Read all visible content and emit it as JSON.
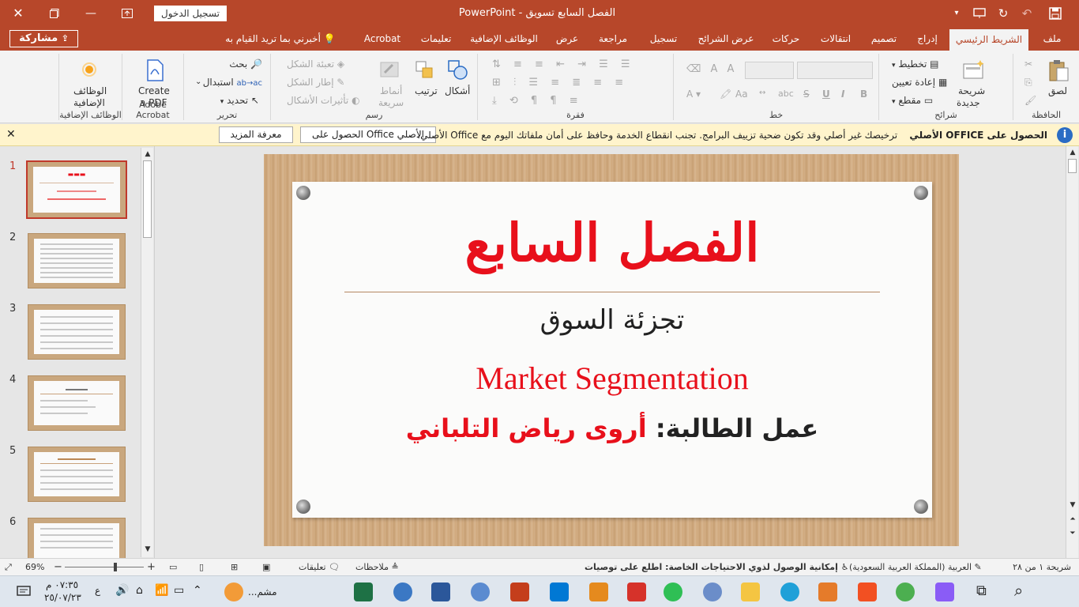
{
  "titlebar": {
    "signin_label": "تسجيل الدخول",
    "document_title": "الفصل السابع تسويق  -  PowerPoint"
  },
  "tabs": {
    "share_label": "مشاركة",
    "items": [
      "ملف",
      "الشريط الرئيسي",
      "إدراج",
      "تصميم",
      "انتقالات",
      "حركات",
      "عرض الشرائح",
      "تسجيل",
      "مراجعة",
      "عرض",
      "الوظائف الإضافية",
      "تعليمات",
      "Acrobat"
    ],
    "tell_me": "أخبرني بما تريد القيام به"
  },
  "ribbon": {
    "clipboard": {
      "label": "الحافظة",
      "paste": "لصق"
    },
    "slides": {
      "label": "شرائح",
      "new_slide_1": "شريحة",
      "new_slide_2": "جديدة",
      "layout": "تخطيط",
      "reset": "إعادة تعيين",
      "section": "مقطع"
    },
    "font": {
      "label": "خط",
      "bold": "B",
      "italic": "I",
      "underline": "U",
      "strike": "S",
      "shadow": "abc",
      "aa": "Aa"
    },
    "paragraph": {
      "label": "فقرة"
    },
    "drawing": {
      "label": "رسم",
      "shapes": "أشكال",
      "arrange": "ترتيب",
      "quick_styles_1": "أنماط",
      "quick_styles_2": "سريعة",
      "shape_fill": "تعبئة الشكل",
      "shape_outline": "إطار الشكل",
      "shape_effects": "تأثيرات الأشكال"
    },
    "editing": {
      "label": "تحرير",
      "find": "بحث",
      "replace": "استبدال",
      "select": "تحديد"
    },
    "acrobat": {
      "label": "Adobe Acrobat",
      "create_1": "Create",
      "create_2": "a PDF"
    },
    "addins": {
      "label": "الوظائف الإضافية",
      "addins_1": "الوظائف",
      "addins_2": "الإضافية"
    }
  },
  "notification": {
    "bold_text": "الحصول على OFFICE الأصلي",
    "text": "ترخيصك غير أصلي وقد تكون ضحية تزييف البرامج. تجنب انقطاع الخدمة وحافظ على أمان ملفاتك اليوم مع Office الأصلي.",
    "get_button": "الحصول على Office الأصلي",
    "learn_button": "معرفة المزيد"
  },
  "thumbnails": [
    "1",
    "2",
    "3",
    "4",
    "5",
    "6"
  ],
  "slide": {
    "title": "الفصل السابع",
    "subtitle": "تجزئة السوق",
    "english_title": "Market Segmentation",
    "author_label": "عمل الطالبة:",
    "author_name": "أروى رياض التلباني"
  },
  "statusbar": {
    "slide_count": "شريحة ١ من ٢٨",
    "language": "العربية (المملكة العربية السعودية)",
    "accessibility": "إمكانية الوصول لذوي الاحتياجات الخاصة: اطلع على توصيات",
    "notes": "ملاحظات",
    "comments": "تعليقات",
    "zoom": "69%"
  },
  "taskbar": {
    "time": "٠٧:٣٥ م",
    "date": "٢٥/٠٧/٢٣",
    "lang": "ع",
    "running_label": "مشم..."
  },
  "colors": {
    "accent": "#b7472a",
    "title_red": "#e8101b"
  }
}
